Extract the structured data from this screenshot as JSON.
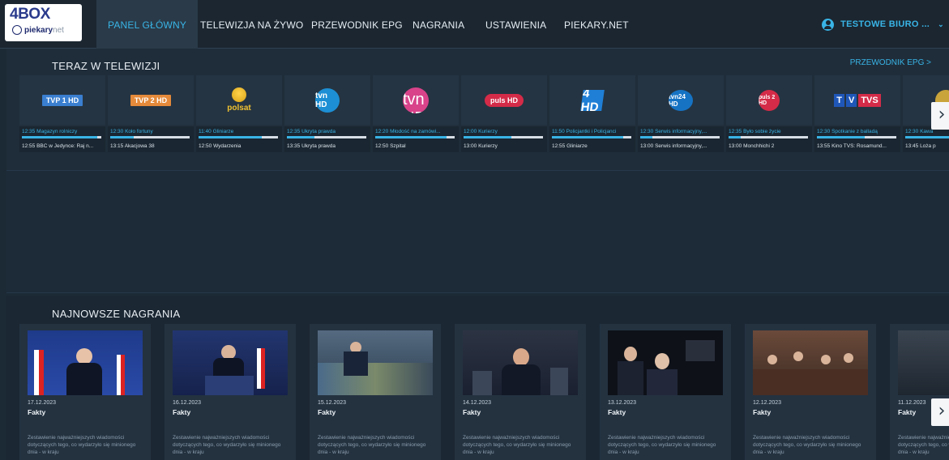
{
  "brand": {
    "logo_main": "4BOX",
    "logo_sub": "piekary",
    "logo_sub2": "net"
  },
  "nav": {
    "items": [
      {
        "label": "PANEL GŁÓWNY",
        "active": true
      },
      {
        "label": "TELEWIZJA NA ŻYWO",
        "active": false
      },
      {
        "label": "PRZEWODNIK EPG",
        "active": false
      },
      {
        "label": "NAGRANIA",
        "active": false
      },
      {
        "label": "USTAWIENIA",
        "active": false
      },
      {
        "label": "PIEKARY.NET",
        "active": false
      }
    ],
    "user_label": "TESTOWE BIURO ...",
    "user_chevron": "⌄"
  },
  "live": {
    "title": "TERAZ W TELEWIZJI",
    "epg_link": "PRZEWODNIK EPG >",
    "next_arrow": "›",
    "channels": [
      {
        "logo_text": "TVP 1 HD",
        "logo_style": "tvp1",
        "now": "12:35 Magazyn rolniczy",
        "progress": 0.95,
        "next": "12:55 BBC w Jedynce: Raj n..."
      },
      {
        "logo_text": "TVP 2 HD",
        "logo_style": "tvp2",
        "now": "12:30 Koło fortuny",
        "progress": 0.3,
        "next": "13:15 Akacjowa 38"
      },
      {
        "logo_text": "polsat",
        "logo_style": "polsat",
        "now": "11:40 Gliniarze",
        "progress": 0.8,
        "next": "12:50 Wydarzenia"
      },
      {
        "logo_text": "tvn HD",
        "logo_style": "tvn",
        "now": "12:35 Ukryta prawda",
        "progress": 0.35,
        "next": "13:35 Ukryta prawda"
      },
      {
        "logo_text": "7 tvn HD",
        "logo_style": "tvn7",
        "now": "12:20 Młodość na zamówi...",
        "progress": 0.9,
        "next": "12:50 Szpital"
      },
      {
        "logo_text": "puls HD",
        "logo_style": "puls",
        "now": "12:00 Kurierzy",
        "progress": 0.6,
        "next": "13:00 Kurierzy"
      },
      {
        "logo_text": "4 HD",
        "logo_style": "four",
        "now": "11:50 Policjantki i Policjanci",
        "progress": 0.9,
        "next": "12:55 Gliniarze"
      },
      {
        "logo_text": "tvn24 HD",
        "logo_style": "tvn24",
        "now": "12:30 Serwis informacyjny,...",
        "progress": 0.15,
        "next": "13:00 Serwis informacyjny,..."
      },
      {
        "logo_text": "puls 2 HD",
        "logo_style": "puls2",
        "now": "12:35 Było sobie życie",
        "progress": 0.15,
        "next": "13:00 Monchhichi 2"
      },
      {
        "logo_text": "TVS",
        "logo_style": "tvs",
        "now": "12:30 Spotkanie z balladą",
        "progress": 0.6,
        "next": "13:55 Kino TVS: Rosamund..."
      },
      {
        "logo_text": "",
        "logo_style": "partial",
        "now": "12:30 Kawa",
        "progress": 0.6,
        "next": "13:45 Loża p"
      }
    ]
  },
  "recordings": {
    "title": "NAJNOWSZE NAGRANIA",
    "next_arrow": "›",
    "items": [
      {
        "date": "17.12.2023",
        "title": "Fakty",
        "desc": "Zestawienie najważniejszych wiadomości dotyczących tego, co wydarzyło się minionego dnia - w kraju",
        "thumb": "podium-red"
      },
      {
        "date": "16.12.2023",
        "title": "Fakty",
        "desc": "Zestawienie najważniejszych wiadomości dotyczących tego, co wydarzyło się minionego dnia - w kraju",
        "thumb": "podium-blue"
      },
      {
        "date": "15.12.2023",
        "title": "Fakty",
        "desc": "Zestawienie najważniejszych wiadomości dotyczących tego, co wydarzyło się minionego dnia - w kraju",
        "thumb": "studio"
      },
      {
        "date": "14.12.2023",
        "title": "Fakty",
        "desc": "Zestawienie najważniejszych wiadomości dotyczących tego, co wydarzyło się minionego dnia - w kraju",
        "thumb": "interview"
      },
      {
        "date": "13.12.2023",
        "title": "Fakty",
        "desc": "Zestawienie najważniejszych wiadomości dotyczących tego, co wydarzyło się minionego dnia - w kraju",
        "thumb": "two-men"
      },
      {
        "date": "12.12.2023",
        "title": "Fakty",
        "desc": "Zestawienie najważniejszych wiadomości dotyczących tego, co wydarzyło się minionego dnia - w kraju",
        "thumb": "parliament"
      },
      {
        "date": "11.12.2023",
        "title": "Fakty",
        "desc": "Zestawienie najważniejszych wiadomości dotyczących tego, co wydarzyło się minionego dnia - w kraju",
        "thumb": "partial"
      }
    ]
  }
}
